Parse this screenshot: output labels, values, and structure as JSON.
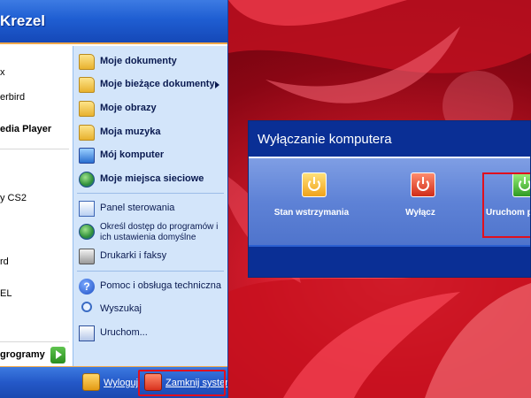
{
  "start_menu": {
    "user_name": "Krezel",
    "left_items": [
      {
        "label": "x",
        "bold": false
      },
      {
        "label": "erbird",
        "bold": false
      },
      {
        "label": "edia Player",
        "bold": true
      },
      {
        "label": "y CS2",
        "bold": false
      },
      {
        "label": "rd",
        "bold": false
      },
      {
        "label": "EL",
        "bold": false
      }
    ],
    "all_programs_label": "grogramy",
    "right_items": [
      {
        "label": "Moje dokumenty",
        "icon": "folder-icon"
      },
      {
        "label": "Moje bieżące dokumenty",
        "icon": "folder-icon"
      },
      {
        "label": "Moje obrazy",
        "icon": "folder-icon"
      },
      {
        "label": "Moja muzyka",
        "icon": "folder-icon"
      },
      {
        "label": "Mój komputer",
        "icon": "computer-icon"
      },
      {
        "label": "Moje miejsca sieciowe",
        "icon": "network-icon"
      },
      {
        "label": "Panel sterowania",
        "icon": "control-panel-icon"
      },
      {
        "label": "Określ dostęp do programów i ich ustawienia domyślne",
        "icon": "globe-icon"
      },
      {
        "label": "Drukarki i faksy",
        "icon": "printer-icon"
      },
      {
        "label": "Pomoc i obsługa techniczna",
        "icon": "help-icon"
      },
      {
        "label": "Wyszukaj",
        "icon": "search-icon"
      },
      {
        "label": "Uruchom...",
        "icon": "run-icon"
      }
    ],
    "footer": {
      "logoff_label": "Wyloguj",
      "shutdown_label": "Zamknij system"
    }
  },
  "shutdown_dialog": {
    "title": "Wyłączanie komputera",
    "buttons": [
      {
        "label": "Stan wstrzymania",
        "icon": "standby-icon"
      },
      {
        "label": "Wyłącz",
        "icon": "power-off-icon"
      },
      {
        "label": "Uruchom p",
        "icon": "restart-icon"
      }
    ]
  },
  "colors": {
    "xp_blue": "#1f5ed2",
    "highlight_red": "#e0101e",
    "menu_right_bg": "#d3e5fa",
    "dialog_bg": "#5e82d6"
  }
}
